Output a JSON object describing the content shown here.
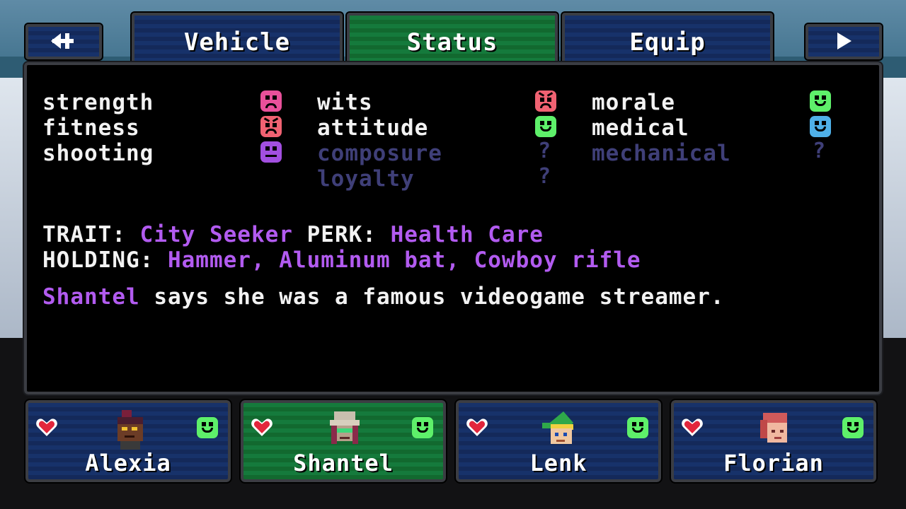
{
  "nav": {
    "back_icon": "back-arrow-icon",
    "next_icon": "play-arrow-icon"
  },
  "tabs": [
    {
      "label": "Vehicle",
      "active": false
    },
    {
      "label": "Status",
      "active": true
    },
    {
      "label": "Equip",
      "active": false
    }
  ],
  "stats": [
    {
      "label": "strength",
      "mood": "sad",
      "color": "#e8509a",
      "known": true
    },
    {
      "label": "fitness",
      "mood": "angry",
      "color": "#f06272",
      "known": true
    },
    {
      "label": "shooting",
      "mood": "neutral",
      "color": "#a24fe0",
      "known": true
    },
    {
      "label": "wits",
      "mood": "angry",
      "color": "#f06272",
      "known": true
    },
    {
      "label": "attitude",
      "mood": "happy",
      "color": "#5ef06a",
      "known": true
    },
    {
      "label": "composure",
      "mood": "unknown",
      "value": "?",
      "known": false
    },
    {
      "label": "loyalty",
      "mood": "unknown",
      "value": "?",
      "known": false
    },
    {
      "label": "morale",
      "mood": "happy",
      "color": "#5ef06a",
      "known": true
    },
    {
      "label": "medical",
      "mood": "happy",
      "color": "#4fb0e8",
      "known": true
    },
    {
      "label": "mechanical",
      "mood": "unknown",
      "value": "?",
      "known": false
    }
  ],
  "info": {
    "trait_label": "TRAIT:",
    "trait_value": "City Seeker",
    "perk_label": "PERK:",
    "perk_value": "Health Care",
    "holding_label": "HOLDING:",
    "holding_value": "Hammer, Aluminum bat, Cowboy rifle",
    "bio_name": "Shantel",
    "bio_text": "says she was a famous videogame streamer."
  },
  "party": [
    {
      "name": "Alexia",
      "active": false,
      "health_icon": "heart-icon",
      "mood_icon": "happy-face-icon"
    },
    {
      "name": "Shantel",
      "active": true,
      "health_icon": "heart-icon",
      "mood_icon": "happy-face-icon"
    },
    {
      "name": "Lenk",
      "active": false,
      "health_icon": "heart-icon",
      "mood_icon": "happy-face-icon"
    },
    {
      "name": "Florian",
      "active": false,
      "health_icon": "heart-icon",
      "mood_icon": "happy-face-icon"
    }
  ],
  "colors": {
    "accent_purple": "#b25bf0",
    "tab_blue": "#17326a",
    "tab_green": "#157a3c",
    "unknown_text": "#3f3f78"
  }
}
